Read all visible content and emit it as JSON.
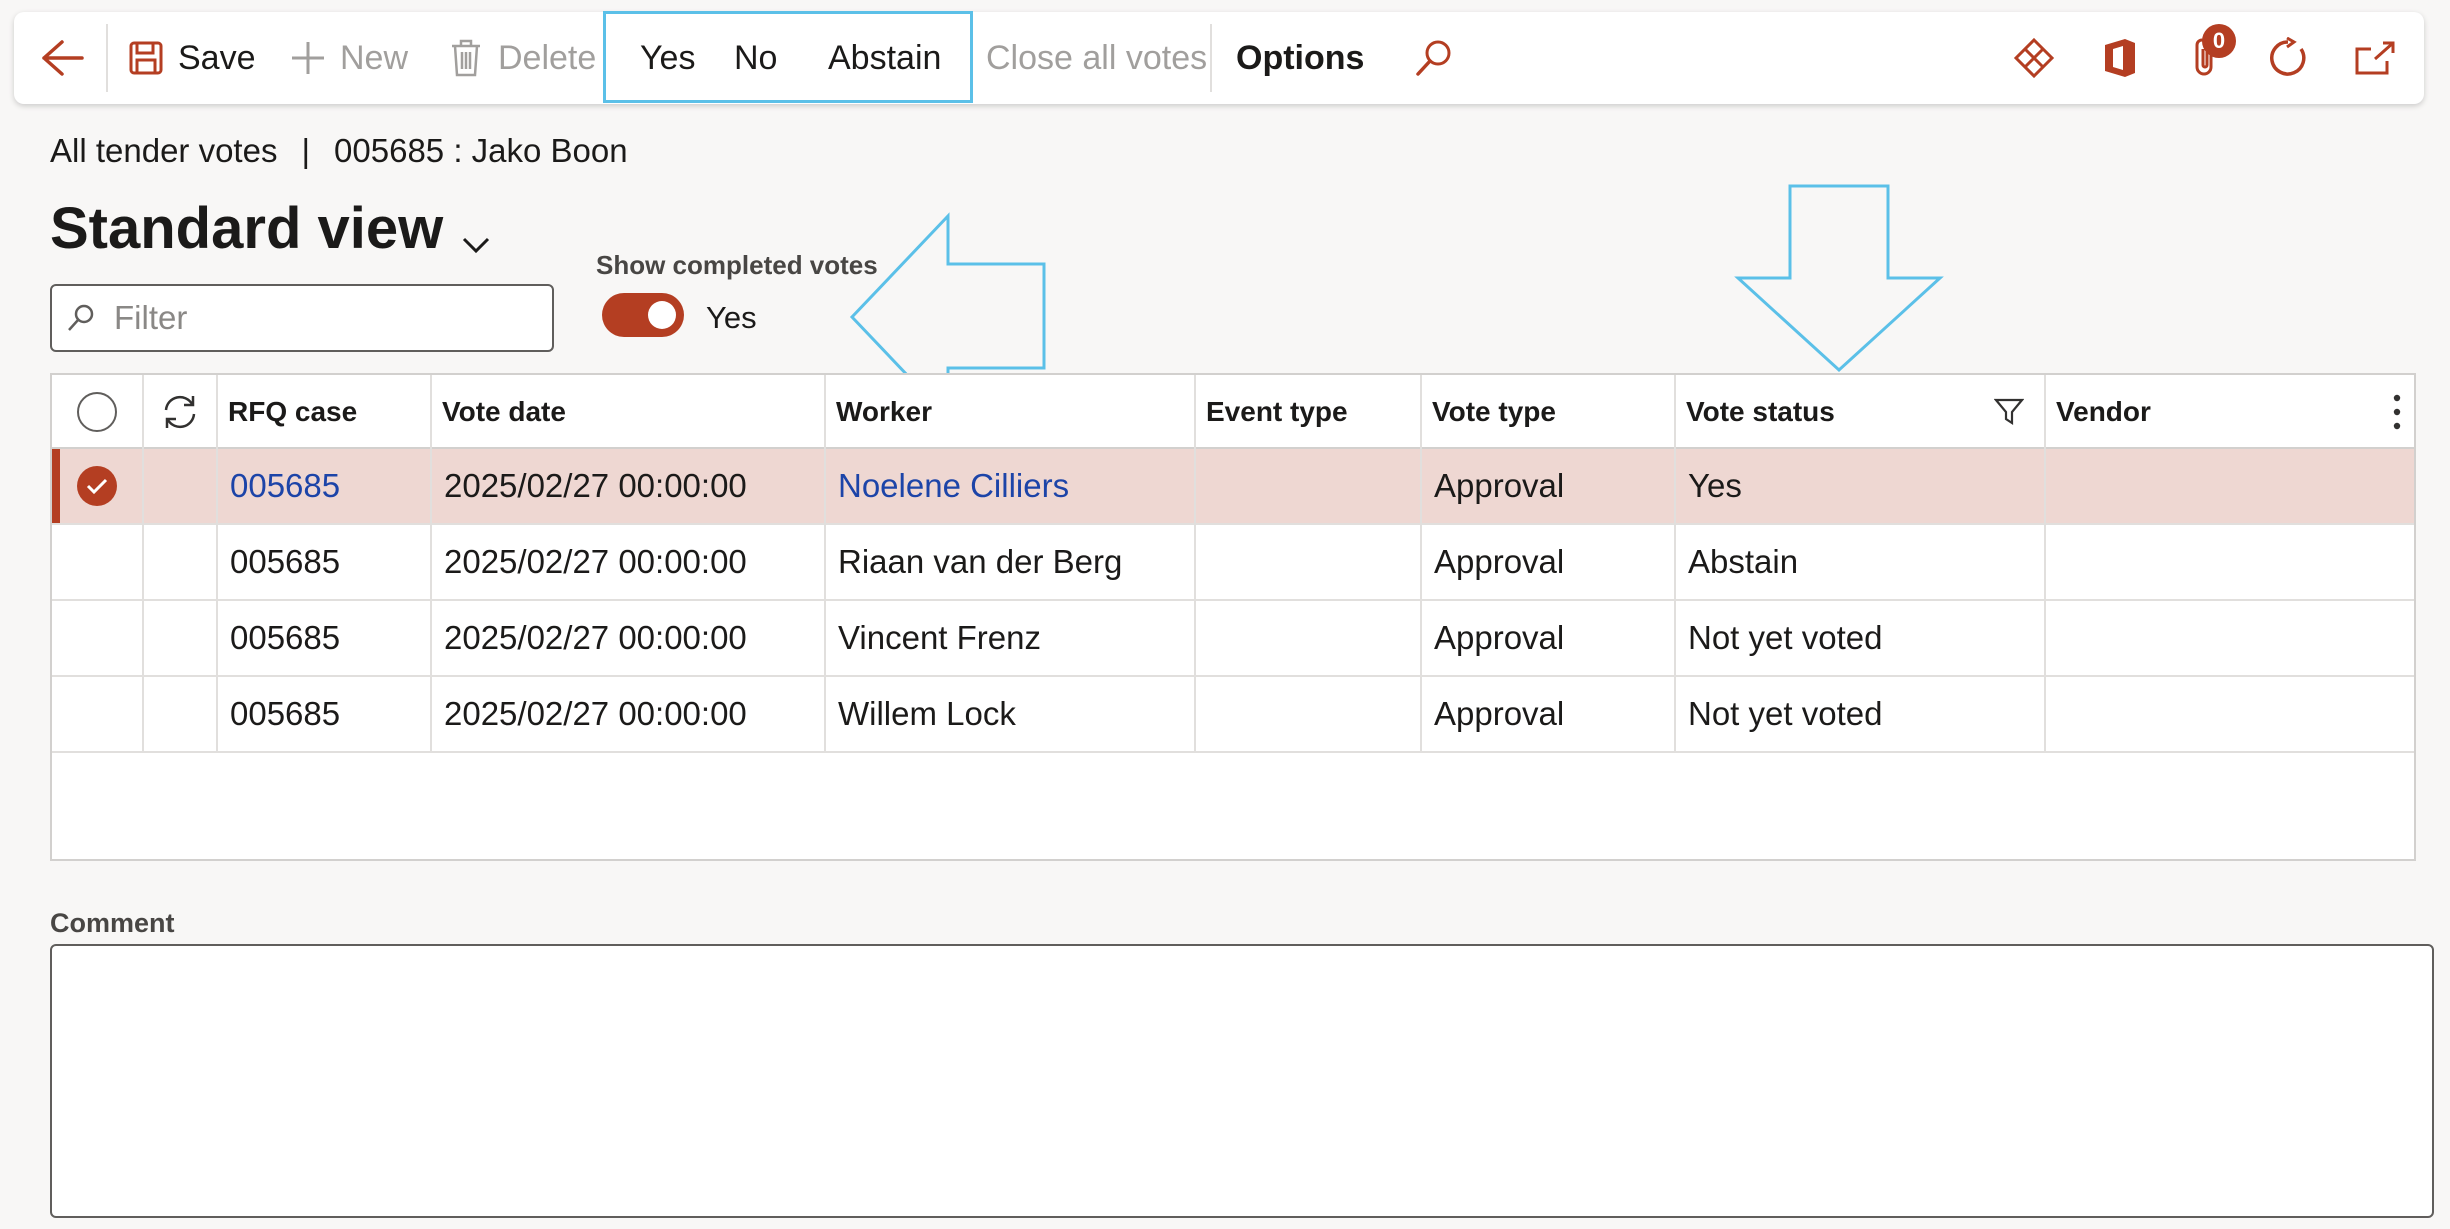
{
  "toolbar": {
    "save": "Save",
    "new": "New",
    "delete": "Delete",
    "yes": "Yes",
    "no": "No",
    "abstain": "Abstain",
    "close_all_votes": "Close all votes",
    "options": "Options",
    "attachments_count": "0"
  },
  "header": {
    "breadcrumb_left": "All tender votes",
    "breadcrumb_sep": "|",
    "breadcrumb_right": "005685 : Jako Boon",
    "view_title": "Standard view"
  },
  "filter": {
    "placeholder": "Filter"
  },
  "toggle": {
    "label": "Show completed votes",
    "value": "Yes"
  },
  "grid": {
    "columns": {
      "rfq_case": "RFQ case",
      "vote_date": "Vote date",
      "worker": "Worker",
      "event_type": "Event type",
      "vote_type": "Vote type",
      "vote_status": "Vote status",
      "vendor": "Vendor"
    },
    "rows": [
      {
        "rfq_case": "005685",
        "vote_date": "2025/02/27 00:00:00",
        "worker": "Noelene Cilliers",
        "event_type": "",
        "vote_type": "Approval",
        "vote_status": "Yes",
        "vendor": ""
      },
      {
        "rfq_case": "005685",
        "vote_date": "2025/02/27 00:00:00",
        "worker": "Riaan van der Berg",
        "event_type": "",
        "vote_type": "Approval",
        "vote_status": "Abstain",
        "vendor": ""
      },
      {
        "rfq_case": "005685",
        "vote_date": "2025/02/27 00:00:00",
        "worker": "Vincent Frenz",
        "event_type": "",
        "vote_type": "Approval",
        "vote_status": "Not yet voted",
        "vendor": ""
      },
      {
        "rfq_case": "005685",
        "vote_date": "2025/02/27 00:00:00",
        "worker": "Willem Lock",
        "event_type": "",
        "vote_type": "Approval",
        "vote_status": "Not yet voted",
        "vendor": ""
      }
    ]
  },
  "comment": {
    "label": "Comment",
    "value": ""
  },
  "colors": {
    "accent": "#b43e22",
    "link": "#1c44a8",
    "annotation": "#5bc0e8",
    "selected_row": "#eed7d2"
  }
}
